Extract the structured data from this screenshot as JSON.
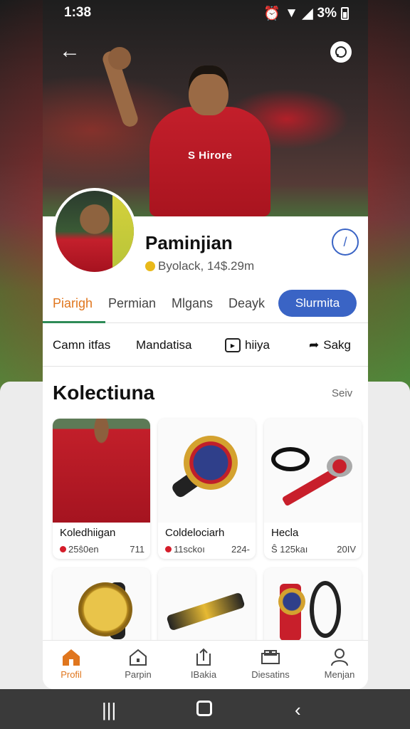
{
  "status": {
    "time": "1:38",
    "battery": "3%"
  },
  "profile": {
    "name": "Paminjian",
    "subtitle": "Byolack, 14$.29m"
  },
  "tabs": [
    "Piarigh",
    "Permian",
    "Mlgans",
    "Deayk"
  ],
  "tab_cta": "Slurmita",
  "actions": [
    "Camn itfas",
    "Mandatisa",
    "hiiya",
    "Sakg"
  ],
  "collection": {
    "title": "Kolectiuna",
    "see_all": "Seiv",
    "cards": [
      {
        "title": "Koledhiigan",
        "price": "25ŝ0en",
        "count": "711"
      },
      {
        "title": "Coldelociarh",
        "price": "11sckoı",
        "count": "224-"
      },
      {
        "title": "Hecla",
        "price": "Ŝ 125kaı",
        "count": "20IV"
      }
    ]
  },
  "jersey_text": "S Hirore",
  "bottom_nav": [
    "Profil",
    "Parpin",
    "IBakia",
    "Diesatins",
    "Menjan"
  ],
  "colors": {
    "accent": "#e0761e",
    "primary": "#3a64c5",
    "kit_red": "#c31f2b"
  }
}
